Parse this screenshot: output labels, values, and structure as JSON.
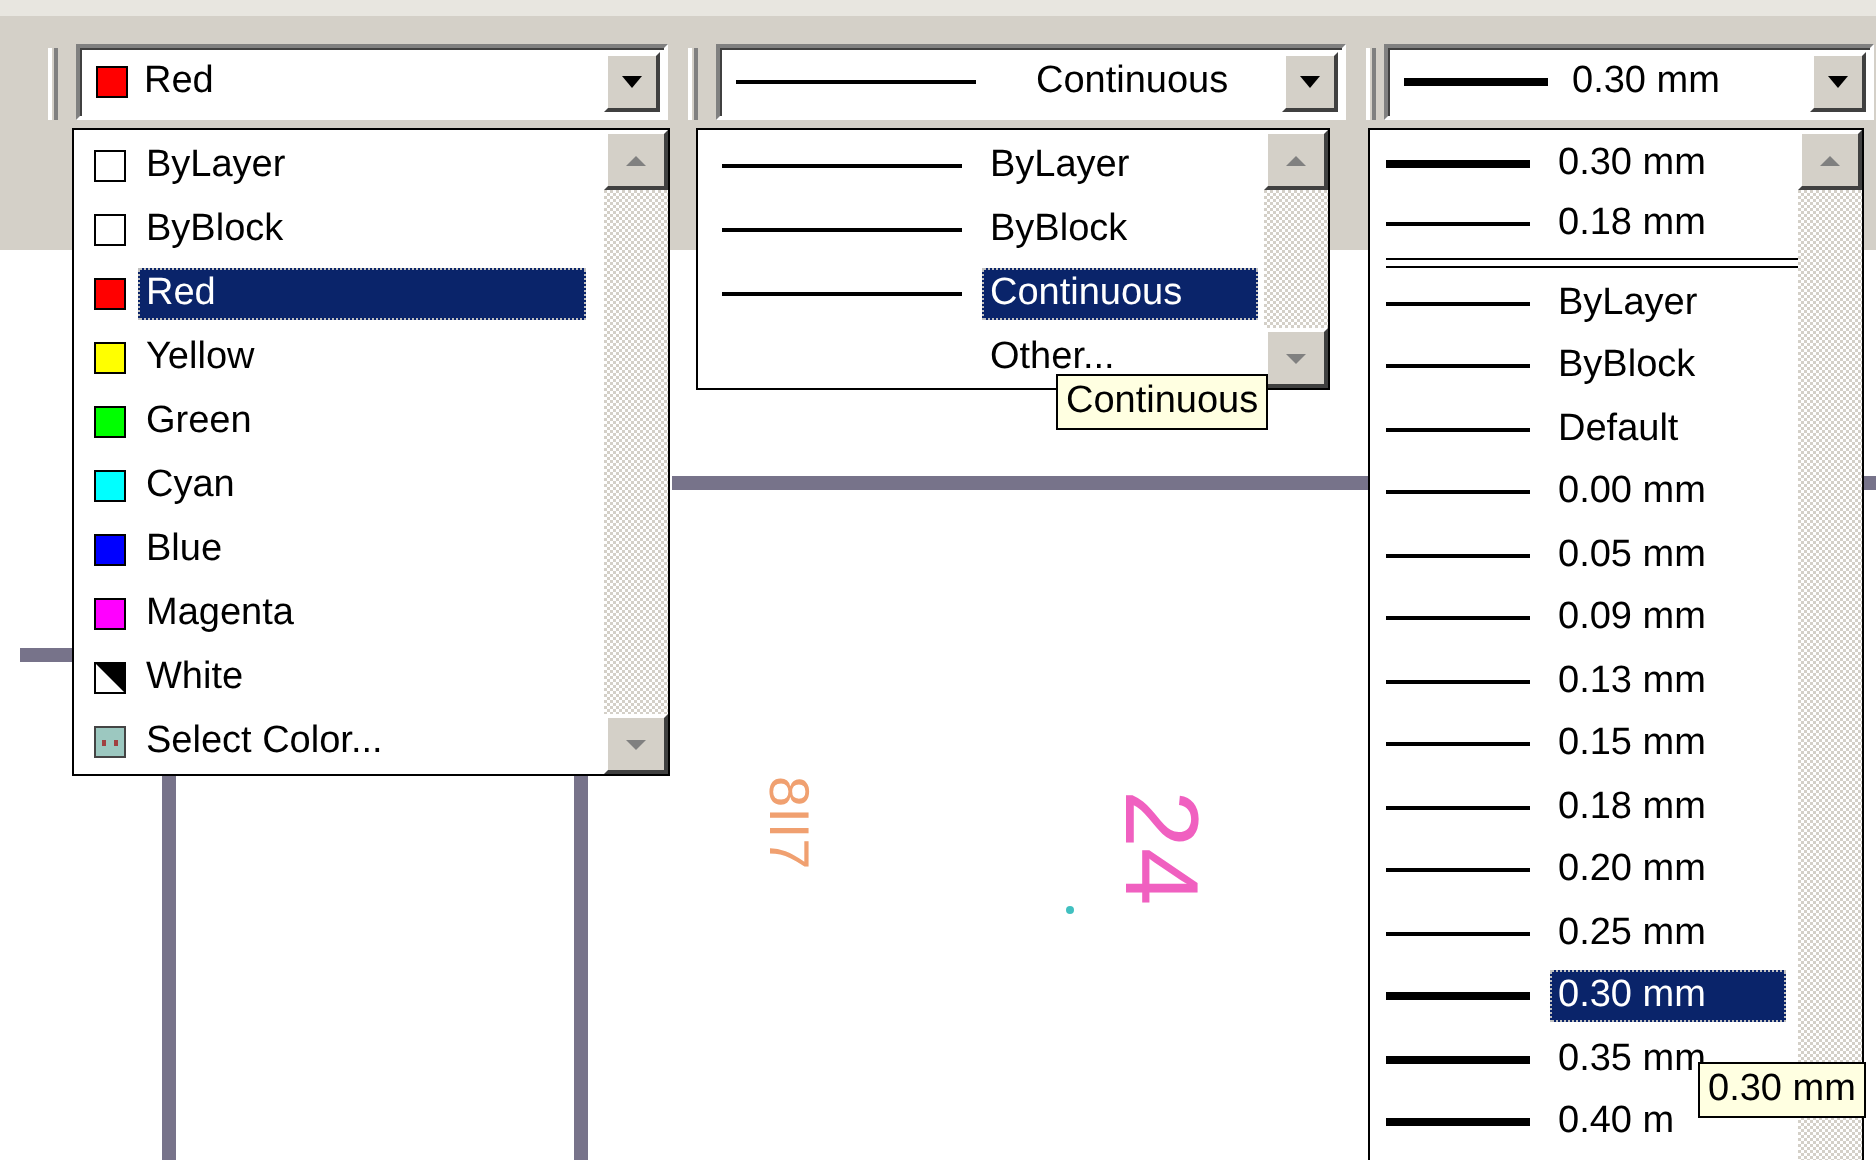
{
  "color_combo": {
    "value": "Red",
    "color": "#ff0000",
    "list": [
      {
        "label": "ByLayer",
        "kind": "swatch",
        "color": "#ffffff",
        "selected": false
      },
      {
        "label": "ByBlock",
        "kind": "swatch",
        "color": "#ffffff",
        "selected": false
      },
      {
        "label": "Red",
        "kind": "swatch",
        "color": "#ff0000",
        "selected": true
      },
      {
        "label": "Yellow",
        "kind": "swatch",
        "color": "#ffff00",
        "selected": false
      },
      {
        "label": "Green",
        "kind": "swatch",
        "color": "#00ff00",
        "selected": false
      },
      {
        "label": "Cyan",
        "kind": "swatch",
        "color": "#00ffff",
        "selected": false
      },
      {
        "label": "Blue",
        "kind": "swatch",
        "color": "#0000ff",
        "selected": false
      },
      {
        "label": "Magenta",
        "kind": "swatch",
        "color": "#ff00ff",
        "selected": false
      },
      {
        "label": "White",
        "kind": "white",
        "selected": false
      },
      {
        "label": "Select Color...",
        "kind": "picker",
        "selected": false
      }
    ]
  },
  "linetype_combo": {
    "value": "Continuous",
    "list": [
      {
        "label": "ByLayer",
        "kind": "linetype",
        "selected": false
      },
      {
        "label": "ByBlock",
        "kind": "linetype",
        "selected": false
      },
      {
        "label": "Continuous",
        "kind": "linetype",
        "selected": true
      },
      {
        "label": "Other...",
        "kind": "other",
        "selected": false
      }
    ],
    "tooltip": "Continuous"
  },
  "lineweight_combo": {
    "value": "0.30 mm",
    "heavy": true,
    "recent": [
      {
        "label": "0.30 mm",
        "heavy": true
      },
      {
        "label": "0.18 mm",
        "heavy": false
      }
    ],
    "list": [
      {
        "label": "ByLayer",
        "heavy": false,
        "selected": false
      },
      {
        "label": "ByBlock",
        "heavy": false,
        "selected": false
      },
      {
        "label": "Default",
        "heavy": false,
        "selected": false
      },
      {
        "label": "0.00 mm",
        "heavy": false,
        "selected": false
      },
      {
        "label": "0.05 mm",
        "heavy": false,
        "selected": false
      },
      {
        "label": "0.09 mm",
        "heavy": false,
        "selected": false
      },
      {
        "label": "0.13 mm",
        "heavy": false,
        "selected": false
      },
      {
        "label": "0.15 mm",
        "heavy": false,
        "selected": false
      },
      {
        "label": "0.18 mm",
        "heavy": false,
        "selected": false
      },
      {
        "label": "0.20 mm",
        "heavy": false,
        "selected": false
      },
      {
        "label": "0.25 mm",
        "heavy": false,
        "selected": false
      },
      {
        "label": "0.30 mm",
        "heavy": true,
        "selected": true
      },
      {
        "label": "0.35 mm",
        "heavy": true,
        "selected": false
      },
      {
        "label": "0.40 m",
        "heavy": true,
        "selected": false
      }
    ],
    "tooltip": "0.30 mm"
  },
  "drawing": {
    "labels": [
      {
        "text": "8II7",
        "color": "#f0a070"
      },
      {
        "text": "24",
        "color": "#f060c0"
      }
    ]
  }
}
